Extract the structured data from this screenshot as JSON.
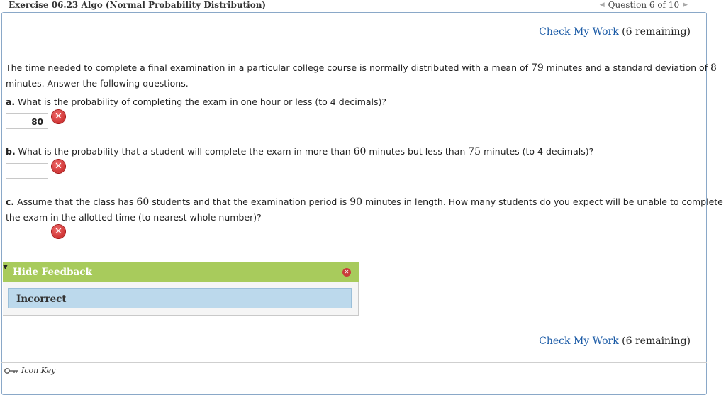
{
  "header": {
    "exercise_title": "Exercise 06.23 Algo (Normal Probability Distribution)",
    "question_position": "Question 6 of 10"
  },
  "check_my_work": {
    "link_label": "Check My Work",
    "remaining_text": "(6 remaining)"
  },
  "problem": {
    "intro_part1": "The time needed to complete a final examination in a particular college course is normally distributed with a mean of ",
    "mean": "79",
    "intro_part2": " minutes and a standard deviation of ",
    "sd": "8",
    "intro_line2": "minutes. Answer the following questions."
  },
  "questions": {
    "a": {
      "label": "a.",
      "text": " What is the probability of completing the exam in one hour or less (to 4 decimals)?",
      "answer_value": "80",
      "status": "incorrect"
    },
    "b": {
      "label": "b.",
      "text_part1": " What is the probability that a student will complete the exam in more than ",
      "num1": "60",
      "text_part2": " minutes but less than ",
      "num2": "75",
      "text_part3": " minutes (to 4 decimals)?",
      "answer_value": "",
      "status": "incorrect"
    },
    "c": {
      "label": "c.",
      "text_part1": " Assume that the class has ",
      "num1": "60",
      "text_part2": " students and that the examination period is ",
      "num2": "90",
      "text_part3": " minutes in length. How many students do you expect will be unable to complete",
      "text_line2": "the exam in the allotted time (to nearest whole number)?",
      "answer_value": "",
      "status": "incorrect"
    }
  },
  "feedback": {
    "toggle_label": "Hide Feedback",
    "message": "Incorrect"
  },
  "footer": {
    "icon_key_label": "Icon Key"
  },
  "icons": {
    "incorrect": "x-circle-icon",
    "close": "close-icon",
    "key": "key-icon"
  },
  "colors": {
    "feedback_header": "#a8cb5c",
    "feedback_body": "#bcd9ec",
    "link": "#1a5aa6",
    "incorrect_red": "#c21d1d"
  }
}
